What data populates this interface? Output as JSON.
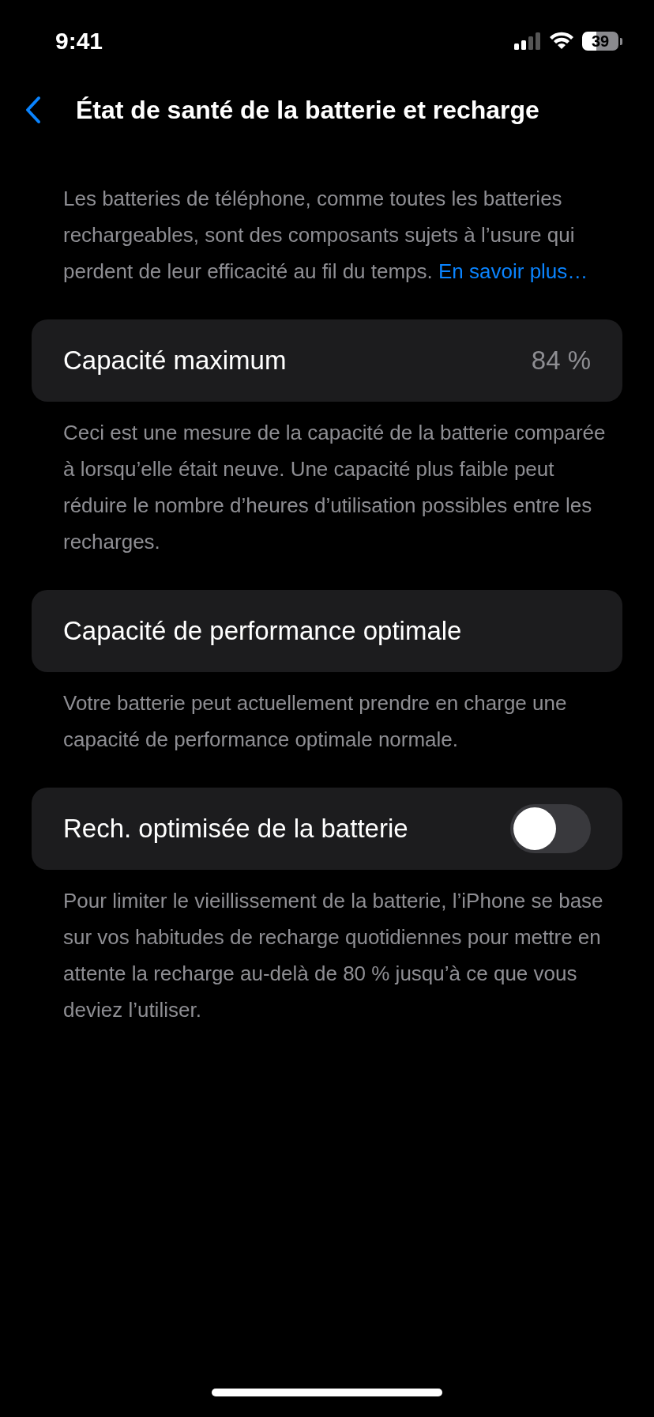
{
  "status_bar": {
    "time": "9:41",
    "battery": "39"
  },
  "nav": {
    "title": "État de santé de la batterie et recharge"
  },
  "intro": {
    "text": "Les batteries de téléphone, comme toutes les batteries rechargeables, sont des composants sujets à l’usure qui perdent de leur efficacité au fil du temps.",
    "link": "En savoir plus…"
  },
  "sections": [
    {
      "kind": "value",
      "label": "Capacité maximum",
      "value": "84 %",
      "footer": "Ceci est une mesure de la capacité de la batterie comparée à lorsqu’elle était neuve. Une capacité plus faible peut réduire le nombre d’heures d’utilisation possibles entre les recharges."
    },
    {
      "kind": "plain",
      "label": "Capacité de performance optimale",
      "footer": "Votre batterie peut actuellement prendre en charge une capacité de performance optimale normale."
    },
    {
      "kind": "toggle",
      "label": "Rech. optimisée de la batterie",
      "on": false,
      "footer": "Pour limiter le vieillissement de la batterie, l’iPhone se base sur vos habitudes de recharge quotidiennes pour mettre en attente la recharge au-delà de 80 % jusqu’à ce que vous deviez l’utiliser."
    }
  ]
}
